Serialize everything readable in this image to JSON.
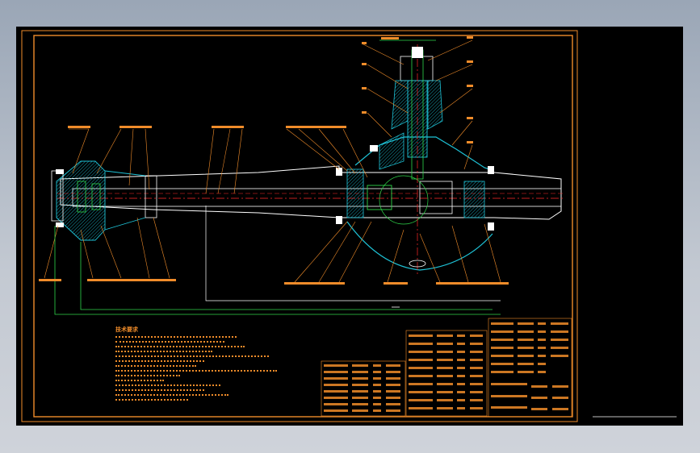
{
  "drawing": {
    "notes_title": "技术要求",
    "accent_orange": "#f08c2a",
    "accent_green": "#2fd64a",
    "accent_cyan": "#1ec2d6",
    "accent_red": "#ff2a2a"
  }
}
